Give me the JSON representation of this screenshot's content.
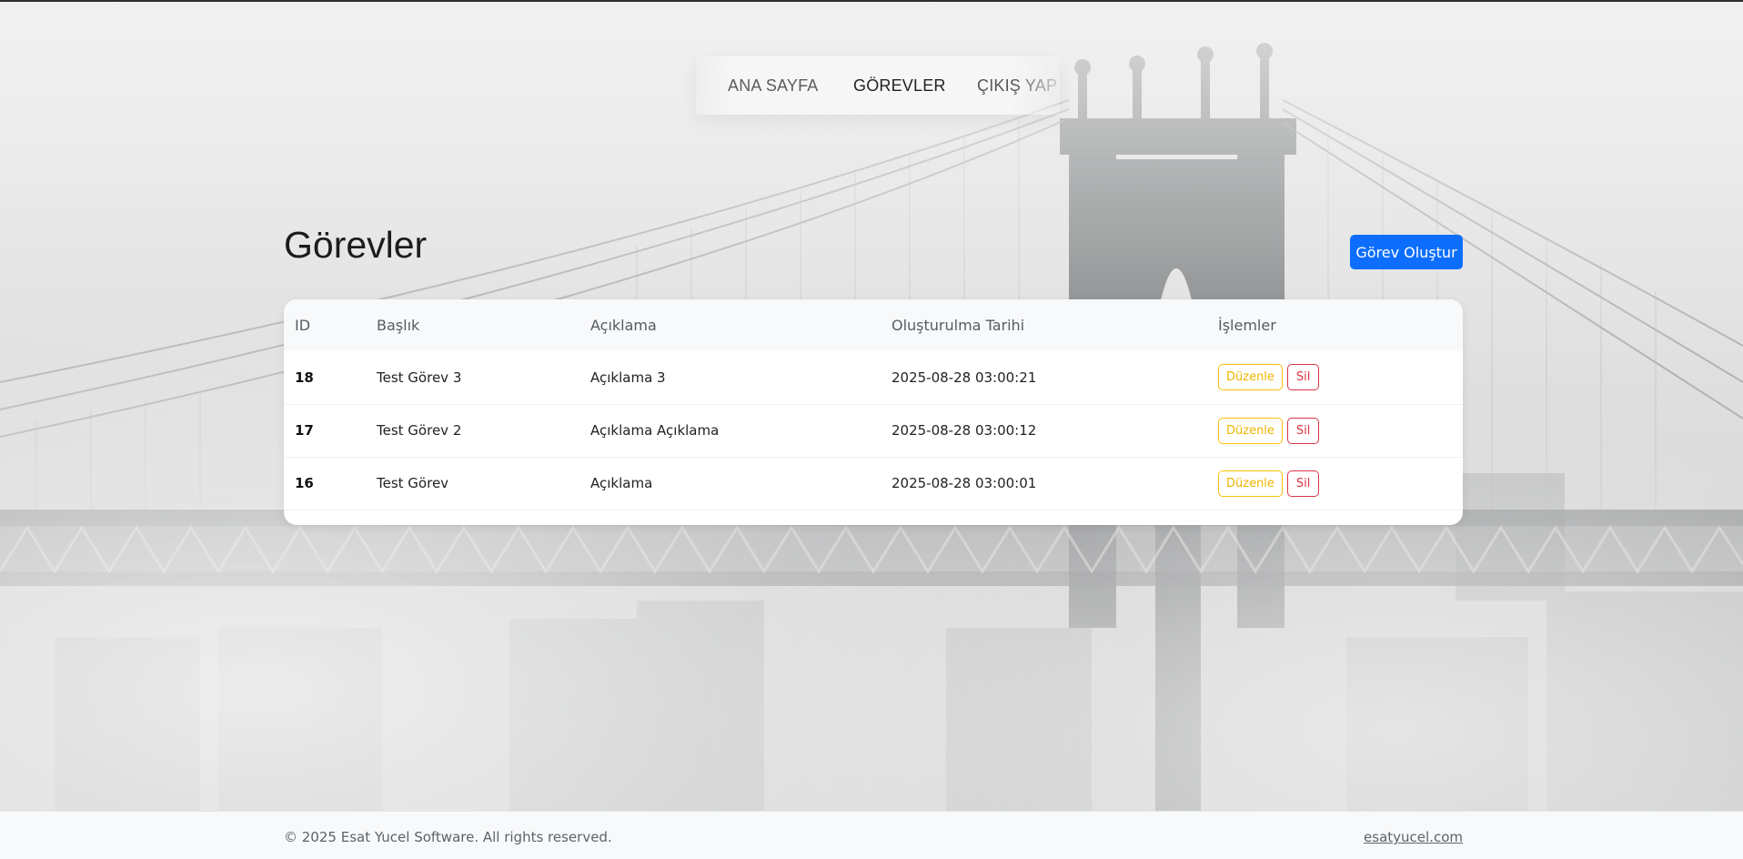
{
  "nav": {
    "items": [
      {
        "label": "ANA SAYFA"
      },
      {
        "label": "GÖREVLER"
      },
      {
        "label": "ÇIKIŞ YAP"
      }
    ]
  },
  "page": {
    "title": "Görevler",
    "create_button": "Görev Oluştur"
  },
  "table": {
    "headers": [
      "ID",
      "Başlık",
      "Açıklama",
      "Oluşturulma Tarihi",
      "İşlemler"
    ],
    "edit_label": "Düzenle",
    "delete_label": "Sil",
    "rows": [
      {
        "id": "18",
        "title": "Test Görev 3",
        "description": "Açıklama 3",
        "created": "2025-08-28 03:00:21"
      },
      {
        "id": "17",
        "title": "Test Görev 2",
        "description": "Açıklama Açıklama",
        "created": "2025-08-28 03:00:12"
      },
      {
        "id": "16",
        "title": "Test Görev",
        "description": "Açıklama",
        "created": "2025-08-28 03:00:01"
      }
    ]
  },
  "footer": {
    "copyright": "© 2025 Esat Yucel Software. All rights reserved.",
    "link": "esatyucel.com"
  },
  "colors": {
    "primary": "#0d6efd",
    "warning": "#ffc107",
    "danger": "#dc3545",
    "footer_bg": "#f8f9fa"
  }
}
